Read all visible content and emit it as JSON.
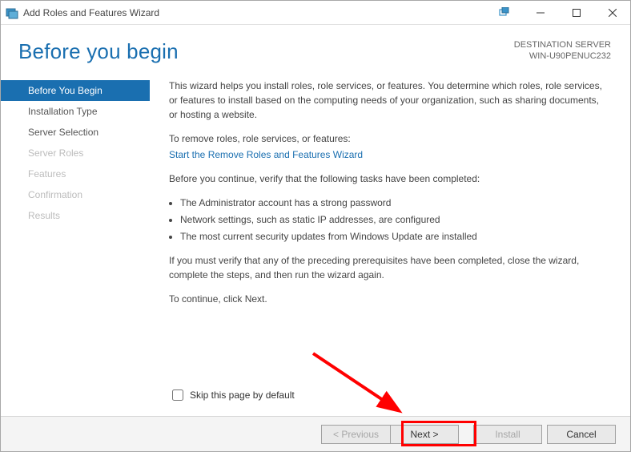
{
  "window": {
    "title": "Add Roles and Features Wizard"
  },
  "header": {
    "heading": "Before you begin",
    "dest_label": "DESTINATION SERVER",
    "server_name": "WIN-U90PENUC232"
  },
  "sidebar": {
    "items": [
      {
        "label": "Before You Begin",
        "active": true,
        "disabled": false
      },
      {
        "label": "Installation Type",
        "active": false,
        "disabled": false
      },
      {
        "label": "Server Selection",
        "active": false,
        "disabled": false
      },
      {
        "label": "Server Roles",
        "active": false,
        "disabled": true
      },
      {
        "label": "Features",
        "active": false,
        "disabled": true
      },
      {
        "label": "Confirmation",
        "active": false,
        "disabled": true
      },
      {
        "label": "Results",
        "active": false,
        "disabled": true
      }
    ]
  },
  "content": {
    "intro": "This wizard helps you install roles, role services, or features. You determine which roles, role services, or features to install based on the computing needs of your organization, such as sharing documents, or hosting a website.",
    "remove_label": "To remove roles, role services, or features:",
    "remove_link": "Start the Remove Roles and Features Wizard",
    "before_continue": "Before you continue, verify that the following tasks have been completed:",
    "bullets": [
      "The Administrator account has a strong password",
      "Network settings, such as static IP addresses, are configured",
      "The most current security updates from Windows Update are installed"
    ],
    "verify_note": "If you must verify that any of the preceding prerequisites have been completed, close the wizard, complete the steps, and then run the wizard again.",
    "continue_note": "To continue, click Next.",
    "skip_label": "Skip this page by default"
  },
  "buttons": {
    "previous": "< Previous",
    "next": "Next >",
    "install": "Install",
    "cancel": "Cancel"
  }
}
